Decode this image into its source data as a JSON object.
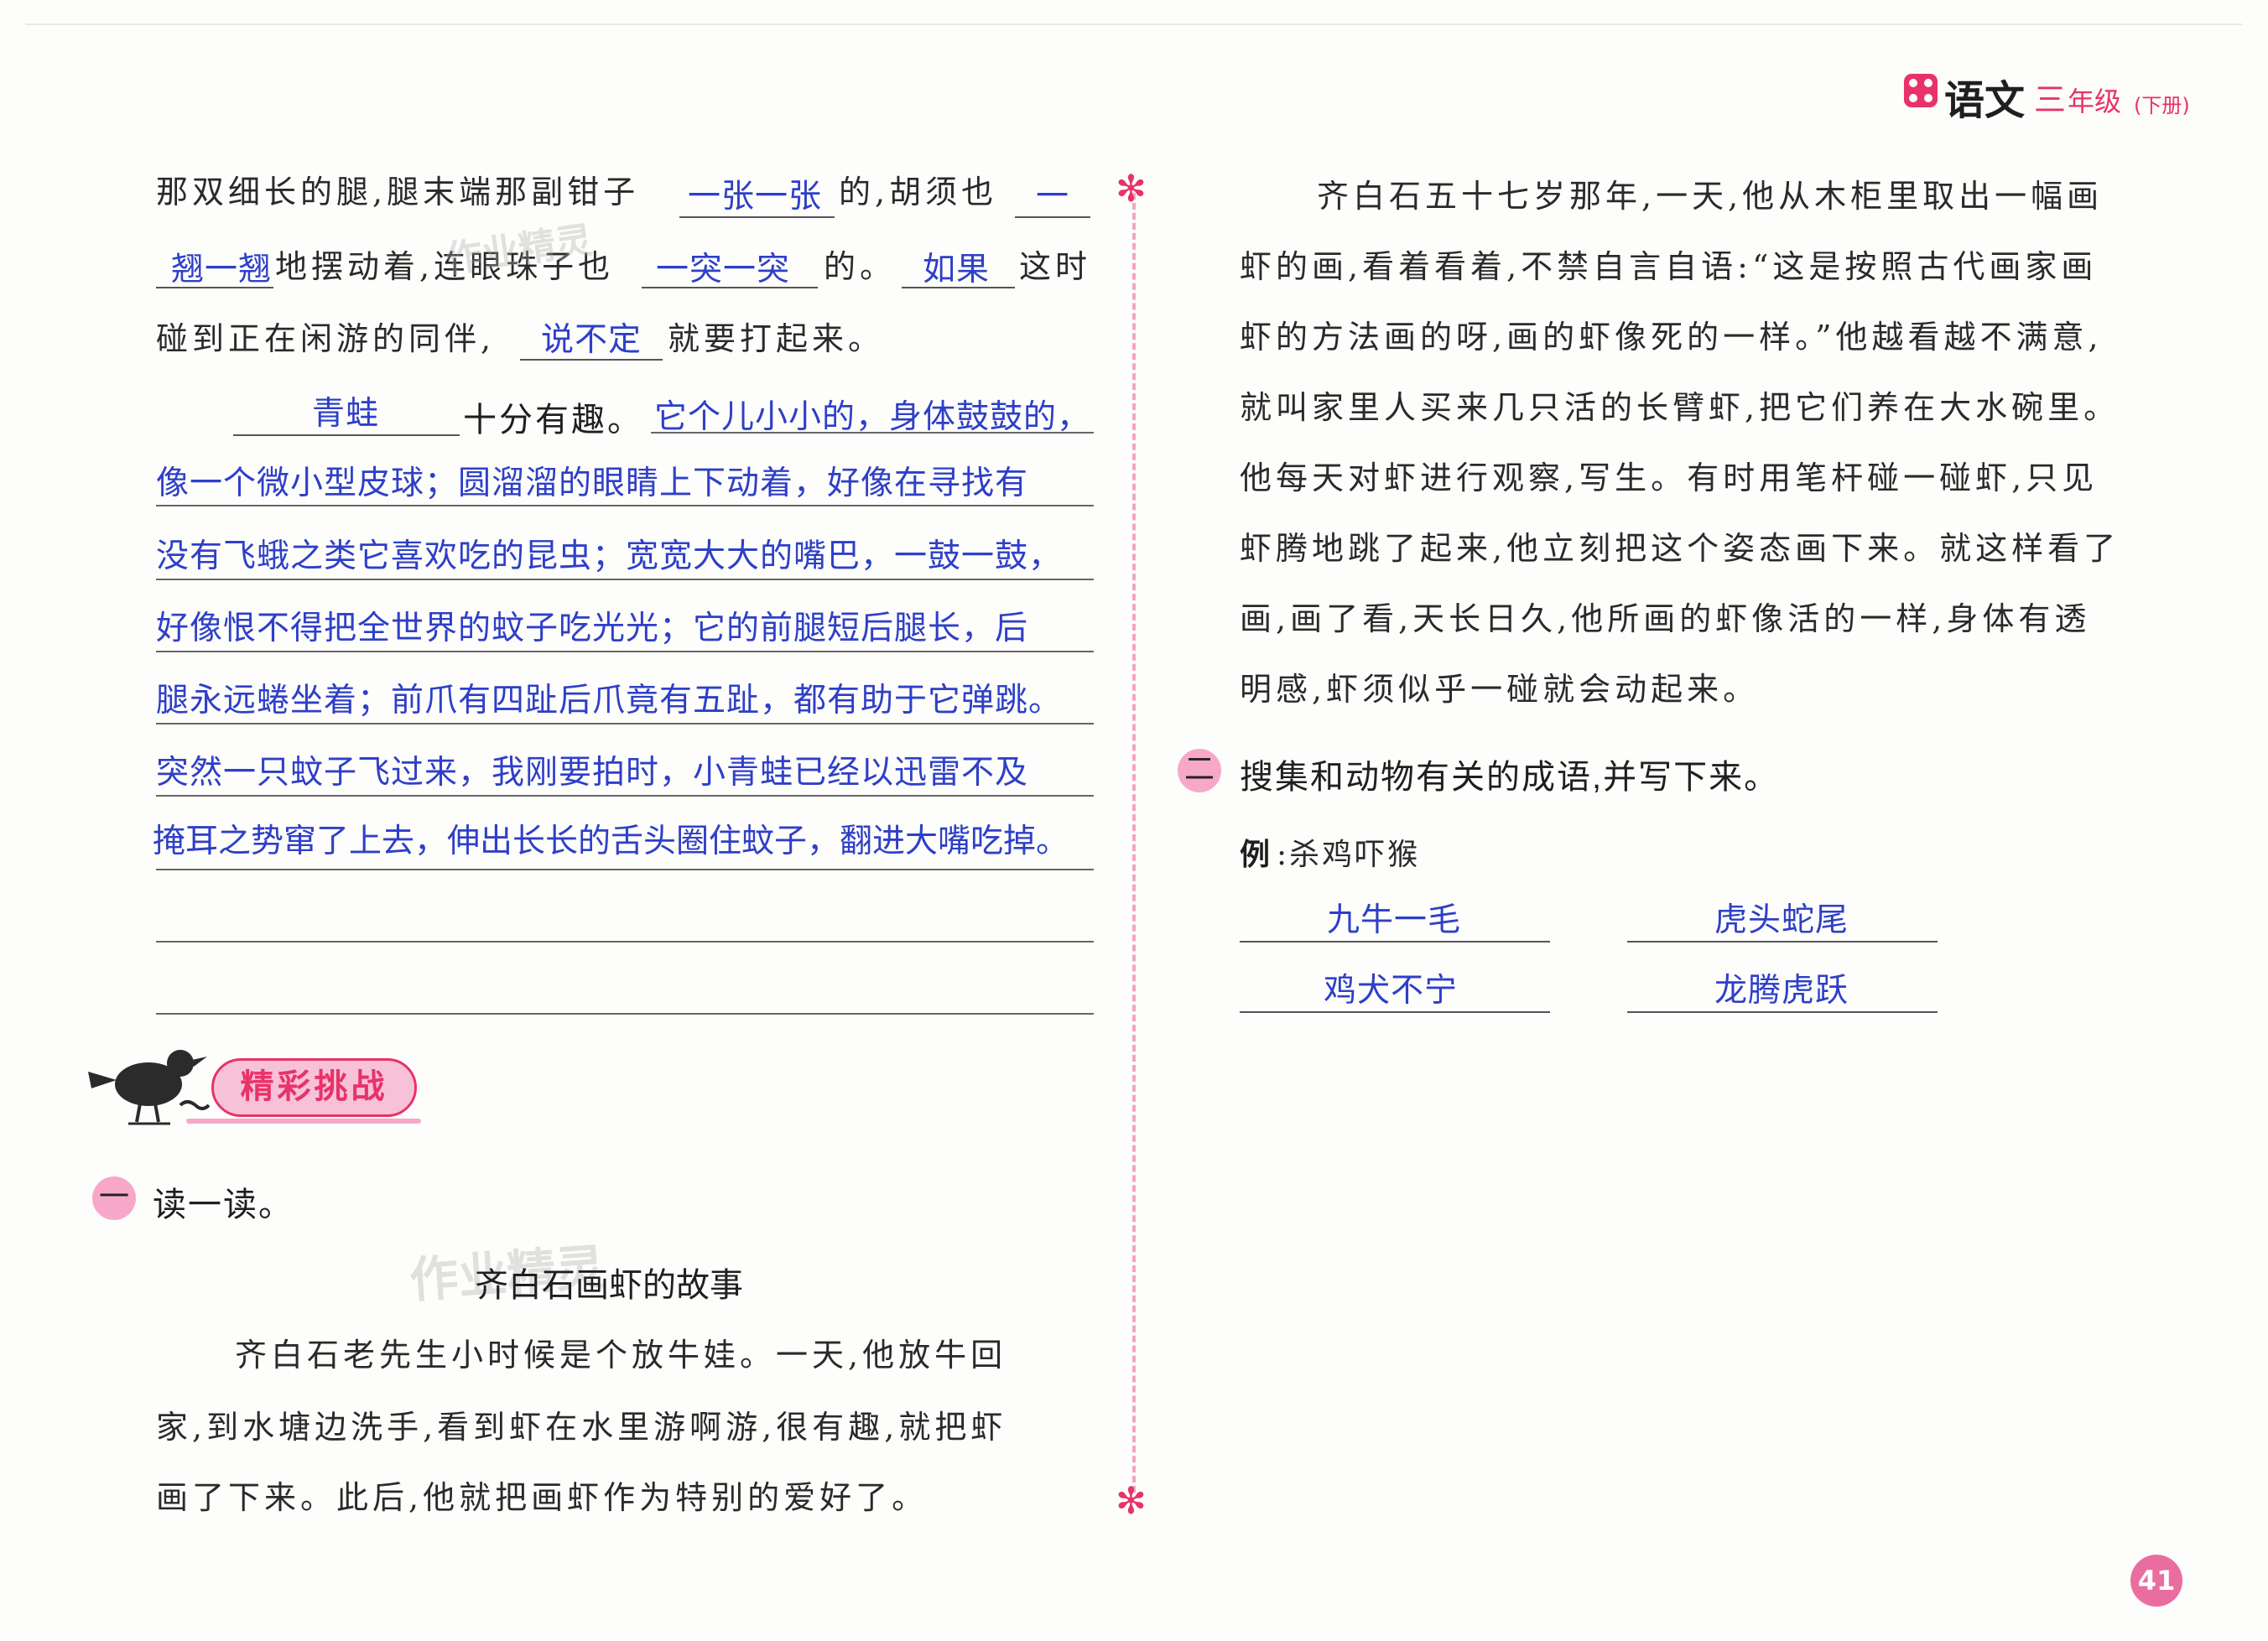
{
  "header": {
    "subject": "语文",
    "grade": "三",
    "grade_suffix": "年级",
    "volume": "(下册)"
  },
  "left": {
    "line1_text": "那双细长的腿,腿末端那副钳子",
    "line1_ans": "一张一张",
    "line1_text2": "的,胡须也",
    "line1_ans2": "一",
    "line2_ans": "翘一翘",
    "line2_text": "地摆动着,连眼珠子也",
    "line2_ans2": "一突一突",
    "line2_text2": "的。",
    "line2_ans3": "如果",
    "line2_text3": "这时",
    "line3_text": "碰到正在闲游的同伴,",
    "line3_ans": "说不定",
    "line3_text2": "就要打起来。",
    "para2_ans": "青蛙",
    "para2_text": "十分有趣。",
    "handwriting": [
      "它个儿小小的，身体鼓鼓的，",
      "像一个微小型皮球；圆溜溜的眼睛上下动着，好像在寻找有",
      "没有飞蛾之类它喜欢吃的昆虫；宽宽大大的嘴巴，一鼓一鼓，",
      "好像恨不得把全世界的蚊子吃光光；它的前腿短后腿长，后",
      "腿永远蜷坐着；前爪有四趾后爪竟有五趾，都有助于它弹跳。",
      "突然一只蚊子飞过来，我刚要拍时，小青蛙已经以迅雷不及",
      "掩耳之势窜了上去，伸出长长的舌头圈住蚊子，翻进大嘴吃掉。"
    ],
    "challenge_label": "精彩挑战",
    "q1_num": "一",
    "q1_text": "读一读。",
    "story_title": "齐白石画虾的故事",
    "story_lines": [
      "齐白石老先生小时候是个放牛娃。一天,他放牛回",
      "家,到水塘边洗手,看到虾在水里游啊游,很有趣,就把虾",
      "画了下来。此后,他就把画虾作为特别的爱好了。"
    ]
  },
  "right": {
    "story_lines": [
      "齐白石五十七岁那年,一天,他从木柜里取出一幅画",
      "虾的画,看着看着,不禁自言自语:“这是按照古代画家画",
      "虾的方法画的呀,画的虾像死的一样。”他越看越不满意,",
      "就叫家里人买来几只活的长臂虾,把它们养在大水碗里。",
      "他每天对虾进行观察,写生。有时用笔杆碰一碰虾,只见",
      "虾腾地跳了起来,他立刻把这个姿态画下来。就这样看了",
      "画,画了看,天长日久,他所画的虾像活的一样,身体有透",
      "明感,虾须似乎一碰就会动起来。"
    ],
    "q2_num": "二",
    "q2_text": "搜集和动物有关的成语,并写下来。",
    "example_label": "例",
    "example_text": ":杀鸡吓猴",
    "answers": [
      "九牛一毛",
      "虎头蛇尾",
      "鸡犬不宁",
      "龙腾虎跃"
    ]
  },
  "watermark": "作业精灵",
  "page_number": "41"
}
